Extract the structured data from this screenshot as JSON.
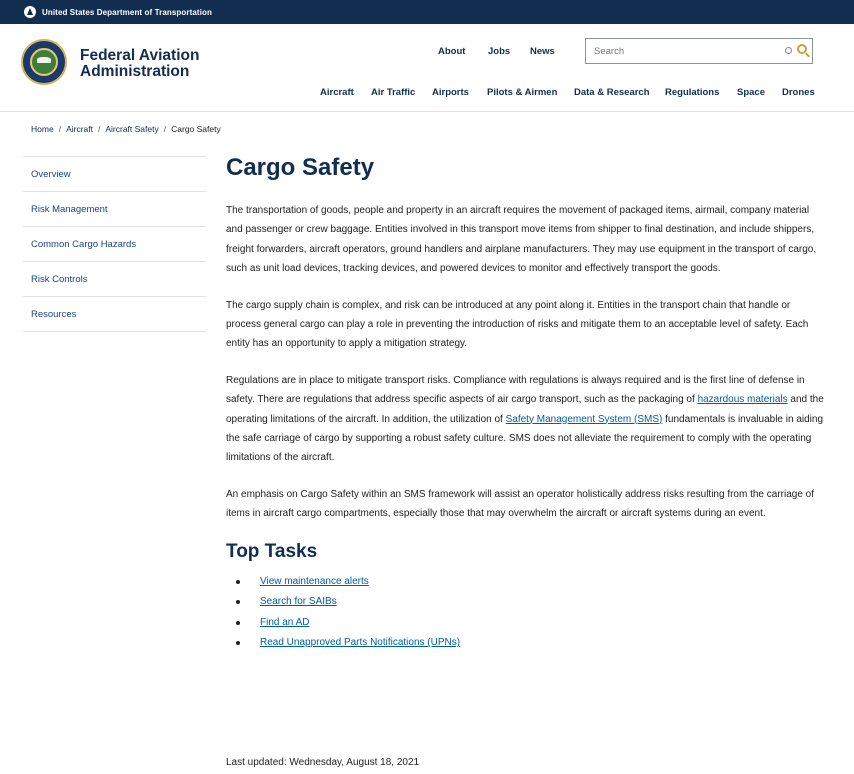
{
  "dot_bar": {
    "text": "United States Department of Transportation"
  },
  "header": {
    "brand_line1": "Federal Aviation",
    "brand_line2": "Administration",
    "util_links": [
      "About",
      "Jobs",
      "News"
    ],
    "search": {
      "placeholder": "Search"
    },
    "main_nav": [
      "Aircraft",
      "Air Traffic",
      "Airports",
      "Pilots & Airmen",
      "Data & Research",
      "Regulations",
      "Space",
      "Drones"
    ]
  },
  "breadcrumb": [
    "Home",
    "Aircraft",
    "Aircraft Safety",
    "Cargo Safety"
  ],
  "sidebar": {
    "items": [
      "Overview",
      "Risk Management",
      "Common Cargo Hazards",
      "Risk Controls",
      "Resources"
    ]
  },
  "main": {
    "title": "Cargo Safety",
    "p1": "The transportation of goods, people and property in an aircraft requires the movement of packaged items, airmail, company material and passenger or crew baggage. Entities involved in this transport move items from shipper to final destination, and include shippers, freight forwarders, aircraft operators, ground handlers and airplane manufacturers. They may use equipment in the transport of cargo, such as unit load devices, tracking devices, and powered devices to monitor and effectively transport the goods.",
    "p2": "The cargo supply chain is complex, and risk can be introduced at any point along it. Entities in the transport chain that handle or process general cargo can play a role in preventing the introduction of risks and mitigate them to an acceptable level of safety. Each entity has an opportunity to apply a mitigation strategy.",
    "p3_a": "Regulations are in place to mitigate transport risks. Compliance with regulations is always required and is the first line of defense in safety. There are regulations that address specific aspects of air cargo transport, such as the packaging of ",
    "p3_link1": "hazardous materials",
    "p3_b": " and the operating limitations of the aircraft. In addition, the utilization of ",
    "p3_link2": "Safety Management System (SMS)",
    "p3_c": " fundamentals is invaluable in aiding the safe carriage of cargo by supporting a robust safety culture. SMS does not alleviate the requirement to comply with the operating limitations of the aircraft.",
    "p4": "An emphasis on Cargo Safety within an SMS framework will assist an operator holistically address risks resulting from the carriage of items in aircraft cargo compartments, especially those that may overwhelm the aircraft or aircraft systems during an event.",
    "top_tasks_title": "Top Tasks",
    "top_tasks": [
      "View maintenance alerts",
      "Search for SAIBs",
      "Find an AD",
      "Read Unapproved Parts Notifications (UPNs)"
    ],
    "last_updated": "Last updated: Wednesday, August 18, 2021"
  }
}
